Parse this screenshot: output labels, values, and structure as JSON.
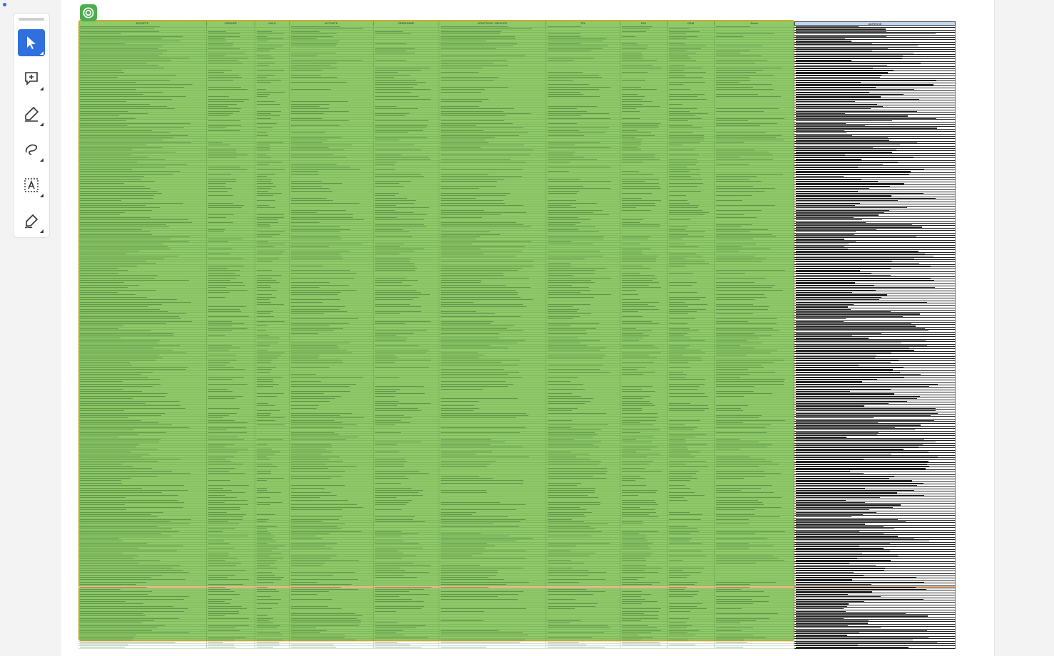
{
  "toolbar": {
    "tools": [
      {
        "name": "select",
        "icon": "cursor-arrow-icon",
        "active": true
      },
      {
        "name": "comment",
        "icon": "comment-plus-icon",
        "active": false
      },
      {
        "name": "highlight",
        "icon": "highlighter-pen-icon",
        "active": false
      },
      {
        "name": "draw",
        "icon": "freehand-draw-icon",
        "active": false
      },
      {
        "name": "text-box",
        "icon": "text-box-icon",
        "active": false
      },
      {
        "name": "sign",
        "icon": "signature-pen-icon",
        "active": false
      }
    ]
  },
  "document": {
    "columns": [
      "SOCIETE",
      "GROUPE",
      "VILLE",
      "ACTIVITE",
      "PERSONNE",
      "FONCTION / SERVICE",
      "TEL",
      "FAX",
      "GSM",
      "Email",
      "ADRESSE"
    ],
    "row_count": 258,
    "highlight_color": "#8fc96a",
    "selection_border_color": "#c9a934",
    "address_header_color": "#bcd7f2",
    "orange_row_color": "#f0b98c"
  },
  "colors": {
    "accent": "#2f6fde",
    "selection_badge": "#4cae4c"
  }
}
